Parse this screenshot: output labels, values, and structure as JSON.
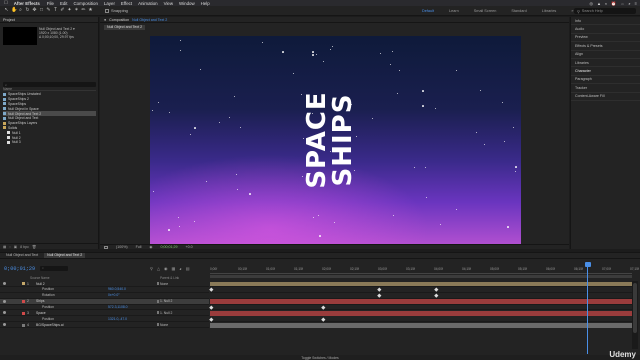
{
  "menubar": {
    "app_name": "After Effects",
    "items": [
      "File",
      "Edit",
      "Composition",
      "Layer",
      "Effect",
      "Animation",
      "View",
      "Window",
      "Help"
    ],
    "status_icons": [
      "◎",
      "▲",
      "◐",
      "⏰",
      "⇔",
      "⌕",
      "≡"
    ]
  },
  "toolbar": {
    "tools": [
      "↖",
      "✋",
      "⌕",
      "↻",
      "✥",
      "□",
      "✎",
      "T",
      "✐",
      "✦",
      "✶",
      "✏",
      "★"
    ],
    "snapping_label": "Snapping",
    "workspaces": [
      "Default",
      "Learn",
      "Small Screen",
      "Standard",
      "Libraries"
    ],
    "active_workspace": "Default",
    "search_placeholder": "Search Help"
  },
  "project": {
    "tab_label": "Project",
    "comp_info": [
      "Null Object and Text 2 ▾",
      "1920 x 1080 (1.00)",
      "Δ 0;00;10;00, 29.97 fps"
    ],
    "search_placeholder": "⌕",
    "column_name": "Name",
    "items": [
      {
        "name": "SpaceShips Unstated",
        "type": "comp",
        "indent": false,
        "selected": false
      },
      {
        "name": "SpaceShips 2",
        "type": "comp",
        "indent": false,
        "selected": false
      },
      {
        "name": "SpaceShips",
        "type": "comp",
        "indent": false,
        "selected": false
      },
      {
        "name": "Null Object in Space",
        "type": "comp",
        "indent": false,
        "selected": false
      },
      {
        "name": "Null Object and Text 2",
        "type": "comp",
        "indent": false,
        "selected": true
      },
      {
        "name": "Null Object and Text",
        "type": "comp",
        "indent": false,
        "selected": false
      },
      {
        "name": "SpaceShips Layers",
        "type": "folder",
        "indent": false,
        "selected": false
      },
      {
        "name": "Solids",
        "type": "folder",
        "indent": false,
        "selected": false
      },
      {
        "name": "Null 1",
        "type": "solid",
        "indent": true,
        "selected": false
      },
      {
        "name": "Null 2",
        "type": "solid",
        "indent": true,
        "selected": false
      },
      {
        "name": "Null 3",
        "type": "solid",
        "indent": true,
        "selected": false
      }
    ],
    "bottom_bpc": "8 bpc"
  },
  "viewer": {
    "panel_prefix": "Composition",
    "comp_name": "Null Object and Text 2",
    "sub_tab": "Null Object and Text 2",
    "title_line1": "SPACE",
    "title_line2": "SHIPS",
    "zoom": "(100%)",
    "resolution": "Full",
    "timecode": "0;00;01;29",
    "exposure": "+0.0"
  },
  "right_panel": {
    "items": [
      "Info",
      "Audio",
      "Preview",
      "Effects & Presets",
      "Align",
      "Libraries",
      "Character",
      "Paragraph",
      "Tracker",
      "Content-Aware Fill"
    ],
    "bold_item": "Character"
  },
  "timeline": {
    "tabs": [
      "Null Object and Text",
      "Null Object and Text 2"
    ],
    "active_tab": "Null Object and Text 2",
    "timecode": "0;00;01;29",
    "search_placeholder": "⌕",
    "col_source": "Source Name",
    "col_parent": "Parent & Link",
    "layers": [
      {
        "num": "1",
        "name": "Null 2",
        "value": "",
        "parent": "None",
        "color": "#c5a86a",
        "prop": false,
        "selected": false
      },
      {
        "num": "",
        "name": "Position",
        "value": "960.0,540.0",
        "parent": "",
        "color": "",
        "prop": true,
        "selected": false
      },
      {
        "num": "",
        "name": "Rotation",
        "value": "0x+0.0°",
        "parent": "",
        "color": "",
        "prop": true,
        "selected": false
      },
      {
        "num": "2",
        "name": "Ships",
        "value": "",
        "parent": "1. Null 2",
        "color": "#d14a4a",
        "prop": false,
        "selected": true
      },
      {
        "num": "",
        "name": "Position",
        "value": "572.3,1108.0",
        "parent": "",
        "color": "",
        "prop": true,
        "selected": false
      },
      {
        "num": "3",
        "name": "Space",
        "value": "",
        "parent": "1. Null 2",
        "color": "#d14a4a",
        "prop": false,
        "selected": false
      },
      {
        "num": "",
        "name": "Position",
        "value": "1321.0,-47.0",
        "parent": "",
        "color": "",
        "prop": true,
        "selected": false
      },
      {
        "num": "4",
        "name": "BG/SpaceShips.ai",
        "value": "",
        "parent": "None",
        "color": "#7a7a7a",
        "prop": false,
        "selected": false
      }
    ],
    "ruler_ticks": [
      "0;00f",
      "00;15f",
      "01;00f",
      "01;15f",
      "02;00f",
      "02;15f",
      "03;00f",
      "03;15f",
      "04;00f",
      "04;15f",
      "05;00f",
      "05;15f",
      "06;00f",
      "06;15f",
      "07;00f",
      "07;15f"
    ],
    "playhead_time": "0;00;01;29",
    "toggle_label": "Toggle Switches / Modes"
  },
  "colors": {
    "accent": "#4a8fe7",
    "panel_bg": "#232323",
    "track_null": "#8a7a58",
    "track_red": "#9a3c3c",
    "track_bg": "#6a6a6a"
  },
  "watermark": "Udemy"
}
